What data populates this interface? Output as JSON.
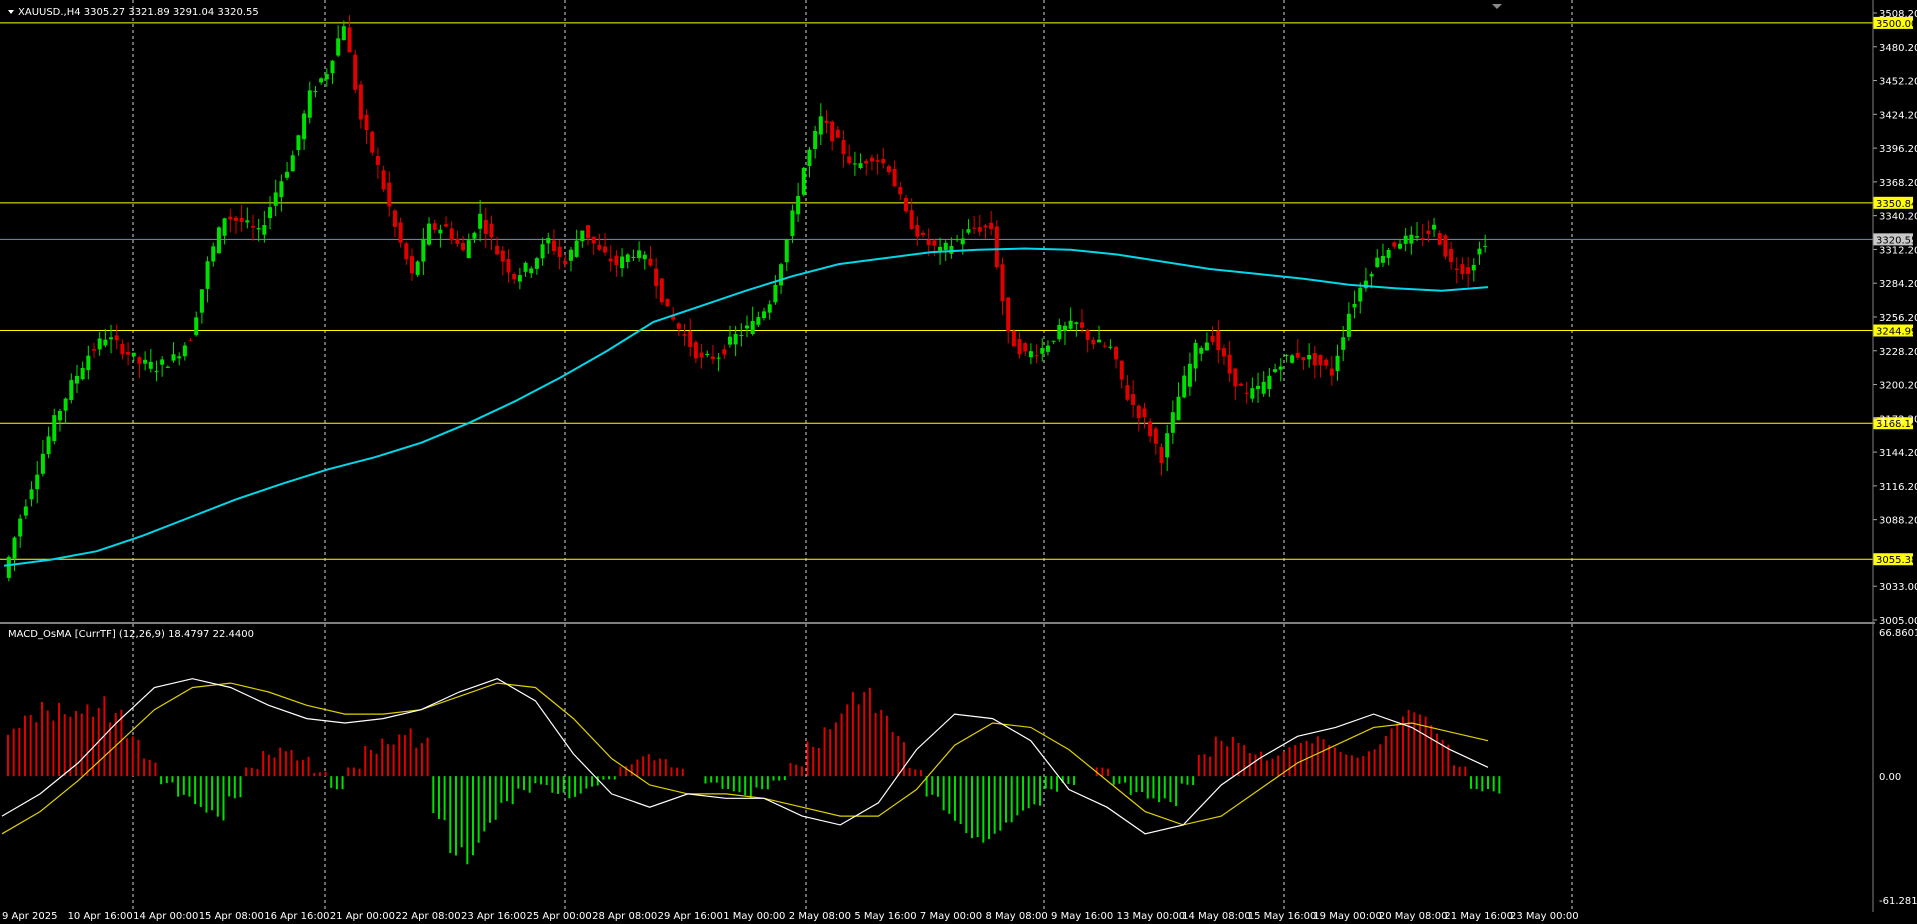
{
  "window": {
    "symbol_header": "XAUUSD.,H4  3305.27 3321.89 3291.04 3320.55",
    "indicator_header": "MACD_OsMA [CurrTF] (12,26,9) 18.4797 22.4400"
  },
  "colors": {
    "background": "#000000",
    "bull": "#00e000",
    "bear": "#e00000",
    "ma": "#00d8e8",
    "level": "#ffff00",
    "macd": "#ffffff",
    "signal": "#e0d000",
    "grid": "#ffffff"
  },
  "price_axis": {
    "ticks": [
      "3508.20",
      "3480.20",
      "3452.20",
      "3424.20",
      "3396.20",
      "3368.20",
      "3340.20",
      "3312.20",
      "3284.20",
      "3256.20",
      "3228.20",
      "3200.20",
      "3172.20",
      "3144.20",
      "3116.20",
      "3088.20",
      "3033.00",
      "3005.00"
    ],
    "ymin": 3005.0,
    "ymax": 3514.0
  },
  "levels": [
    "3500.00",
    "3350.84",
    "3320.55",
    "3244.99",
    "3168.14",
    "3055.38"
  ],
  "indicator_axis": {
    "ticks": [
      "66.8601",
      "0.00",
      "-61.2811"
    ],
    "ymin": -61.2811,
    "ymax": 66.8601
  },
  "time_axis": {
    "labels": [
      "9 Apr 2025",
      "10 Apr 16:00",
      "14 Apr 00:00",
      "15 Apr 08:00",
      "16 Apr 16:00",
      "21 Apr 00:00",
      "22 Apr 08:00",
      "23 Apr 16:00",
      "25 Apr 00:00",
      "28 Apr 08:00",
      "29 Apr 16:00",
      "1 May 00:00",
      "2 May 08:00",
      "5 May 16:00",
      "7 May 00:00",
      "8 May 08:00",
      "9 May 16:00",
      "13 May 00:00",
      "14 May 08:00",
      "15 May 16:00",
      "19 May 00:00",
      "20 May 08:00",
      "21 May 16:00",
      "23 May 00:00"
    ]
  },
  "chart_data": {
    "type": "candlestick",
    "symbol": "XAUUSD.",
    "timeframe": "H4",
    "last": {
      "open": 3305.27,
      "high": 3321.89,
      "low": 3291.04,
      "close": 3320.55
    },
    "close_path": [
      3040,
      3090,
      3130,
      3170,
      3200,
      3225,
      3240,
      3230,
      3218,
      3215,
      3222,
      3240,
      3300,
      3340,
      3335,
      3325,
      3360,
      3390,
      3440,
      3460,
      3500,
      3420,
      3380,
      3330,
      3290,
      3330,
      3330,
      3310,
      3340,
      3310,
      3290,
      3300,
      3320,
      3300,
      3330,
      3310,
      3300,
      3310,
      3300,
      3260,
      3240,
      3220,
      3225,
      3240,
      3250,
      3270,
      3320,
      3380,
      3420,
      3400,
      3380,
      3390,
      3380,
      3340,
      3320,
      3310,
      3320,
      3330,
      3330,
      3240,
      3225,
      3230,
      3245,
      3250,
      3235,
      3230,
      3190,
      3170,
      3140,
      3190,
      3230,
      3240,
      3210,
      3190,
      3200,
      3220,
      3225,
      3220,
      3210,
      3260,
      3290,
      3310,
      3320,
      3320,
      3330,
      3300,
      3295,
      3320
    ],
    "ma_period_note": "",
    "ma_curve": [
      3050,
      3055,
      3062,
      3075,
      3090,
      3105,
      3118,
      3130,
      3140,
      3152,
      3168,
      3186,
      3206,
      3228,
      3252,
      3265,
      3278,
      3290,
      3300,
      3305,
      3310,
      3312,
      3313,
      3312,
      3308,
      3302,
      3296,
      3292,
      3288,
      3283,
      3280,
      3278,
      3281
    ],
    "macd_osma_hist": [
      22,
      28,
      34,
      38,
      40,
      38,
      30,
      18,
      8,
      -4,
      -12,
      -18,
      -20,
      -10,
      4,
      12,
      16,
      10,
      2,
      -6,
      4,
      14,
      20,
      26,
      18,
      -20,
      -36,
      -40,
      -28,
      -16,
      -8,
      -4,
      -8,
      -10,
      -6,
      -2,
      6,
      10,
      8,
      4,
      0,
      -4,
      -8,
      -10,
      -6,
      -2,
      6,
      18,
      30,
      40,
      40,
      30,
      20,
      4,
      -12,
      -22,
      -28,
      -30,
      -26,
      -22,
      -18,
      -8,
      -4,
      0,
      4,
      -4,
      -10,
      -14,
      -14,
      -4,
      10,
      18,
      20,
      14,
      10,
      14,
      16,
      18,
      14,
      12,
      16,
      24,
      30,
      28,
      20,
      6,
      -8,
      -8
    ],
    "macd_line": [
      -18,
      -8,
      6,
      24,
      40,
      44,
      40,
      32,
      26,
      24,
      26,
      30,
      38,
      44,
      34,
      10,
      -8,
      -14,
      -8,
      -10,
      -10,
      -18,
      -22,
      -12,
      12,
      28,
      26,
      16,
      -6,
      -14,
      -26,
      -22,
      -4,
      8,
      18,
      22,
      28,
      22,
      12,
      4
    ],
    "signal_line": [
      -26,
      -16,
      -2,
      14,
      30,
      40,
      42,
      38,
      32,
      28,
      28,
      30,
      36,
      42,
      40,
      26,
      8,
      -4,
      -8,
      -8,
      -10,
      -14,
      -18,
      -18,
      -6,
      14,
      24,
      22,
      12,
      -2,
      -16,
      -22,
      -18,
      -6,
      6,
      14,
      22,
      24,
      20,
      16
    ]
  }
}
